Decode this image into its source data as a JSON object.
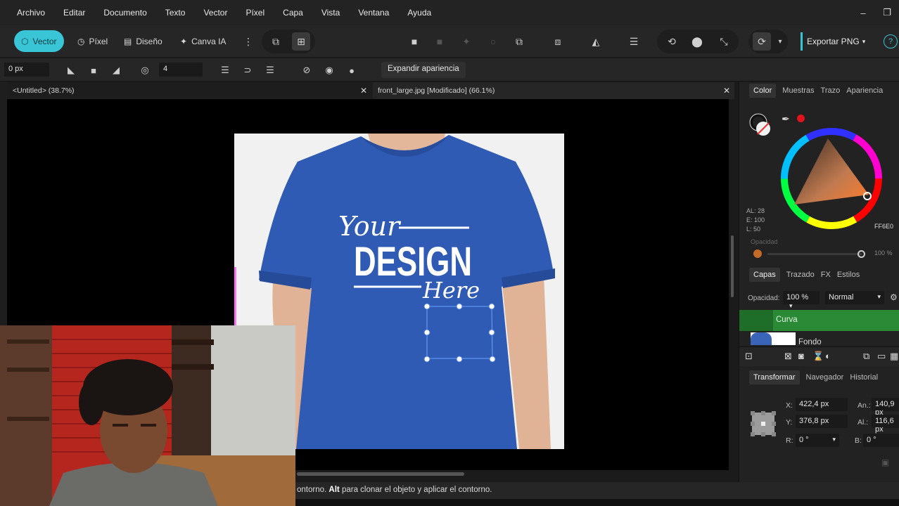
{
  "menu": [
    "Archivo",
    "Editar",
    "Documento",
    "Texto",
    "Vector",
    "Píxel",
    "Capa",
    "Vista",
    "Ventana",
    "Ayuda"
  ],
  "toolbar": {
    "personas": [
      {
        "label": "Vector",
        "icon": "vector-persona-icon",
        "active": true
      },
      {
        "label": "Píxel",
        "icon": "pixel-persona-icon",
        "active": false
      },
      {
        "label": "Diseño",
        "icon": "layout-persona-icon",
        "active": false
      },
      {
        "label": "Canva IA",
        "icon": "sparkle-icon",
        "active": false
      }
    ],
    "export_label": "Exportar PNG",
    "help": "?"
  },
  "context": {
    "stroke_width": "0 px",
    "corners": "4",
    "expand_label": "Expandir apariencia"
  },
  "tabs": [
    {
      "label": "<Untitled> (38.7%)"
    },
    {
      "label": "front_large.jpg [Modificado] (66.1%)"
    }
  ],
  "shirt": {
    "line1": "Your",
    "line2": "DESIGN",
    "line3": "Here"
  },
  "color_panel": {
    "tabs": [
      "Color",
      "Muestras",
      "Trazo",
      "Apariencia"
    ],
    "al": "AL: 28",
    "e": "E: 100",
    "l": "L: 50",
    "hex": "FF6E0",
    "opacity_label": "Opacidad",
    "opacity_value": "100 %",
    "accent": "#ff6e00"
  },
  "layers_panel": {
    "tabs": [
      "Capas",
      "Trazado",
      "FX",
      "Estilos"
    ],
    "opacity_label": "Opacidad:",
    "opacity_value": "100 %",
    "blend_mode": "Normal",
    "layers": [
      "Curva",
      "Fondo"
    ]
  },
  "transform_panel": {
    "tabs": [
      "Transformar",
      "Navegador",
      "Historial"
    ],
    "x_label": "X:",
    "x": "422,4 px",
    "y_label": "Y:",
    "y": "376,8 px",
    "w_label": "An.:",
    "w": "140,9 px",
    "h_label": "Al.:",
    "h": "116,6 px",
    "r_label": "R:",
    "r": "0 °",
    "s_label": "B:",
    "s": "0 °"
  },
  "status": {
    "prefix": "ontorno.",
    "key": "Alt",
    "message": "para clonar el objeto y aplicar el contorno."
  }
}
